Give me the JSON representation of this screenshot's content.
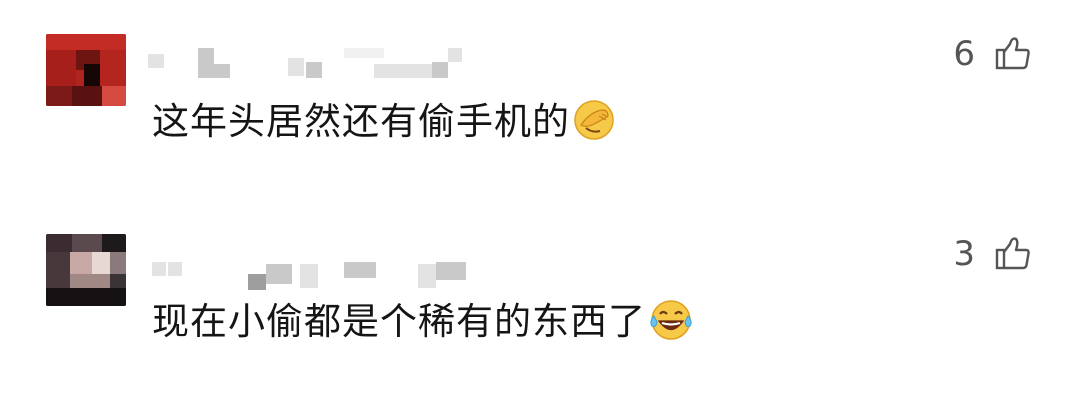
{
  "comments": [
    {
      "text": "这年头居然还有偷手机的",
      "likes": "6",
      "emoji": "facepalm-emoji",
      "avatar": "pixelated-avatar-red",
      "username": "pixelated-username"
    },
    {
      "text": "现在小偷都是个稀有的东西了",
      "likes": "3",
      "emoji": "tears-of-joy-emoji",
      "avatar": "pixelated-avatar-dark",
      "username": "pixelated-username"
    }
  ],
  "icons": {
    "like": "thumbs-up-icon"
  },
  "colors": {
    "text": "#151515",
    "like": "#555555",
    "background": "#ffffff"
  }
}
